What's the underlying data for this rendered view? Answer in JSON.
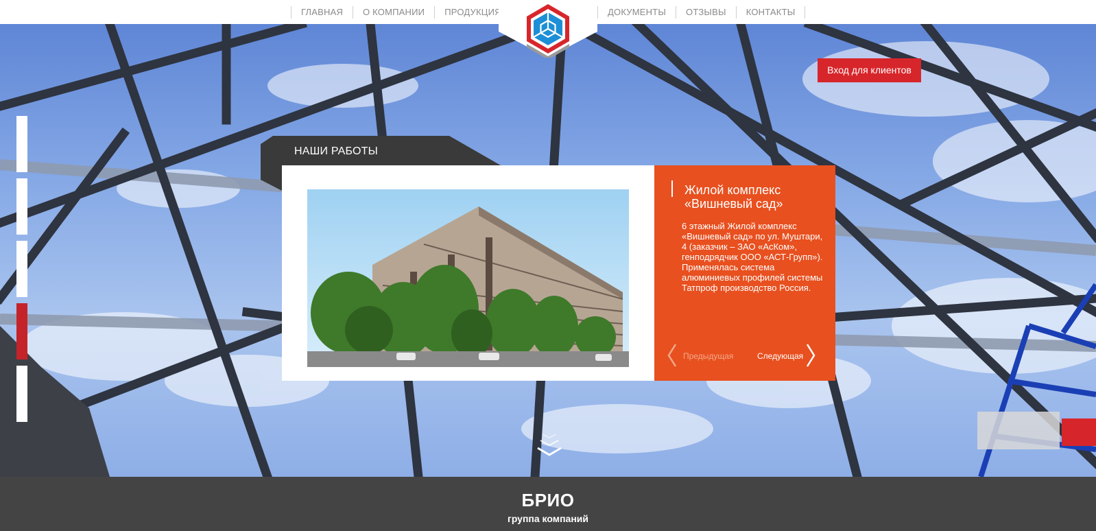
{
  "nav": {
    "left": [
      "ГЛАВНАЯ",
      "О КОМПАНИИ",
      "ПРОДУКЦИЯ"
    ],
    "right": [
      "ДОКУМЕНТЫ",
      "ОТЗЫВЫ",
      "КОНТАКТЫ"
    ]
  },
  "login_label": "Вход для клиентов",
  "works": {
    "section_title": "НАШИ РАБОТЫ",
    "project_title": "Жилой комплекс «Вишневый сад»",
    "project_description": "6 этажный Жилой комплекс «Вишневый сад» по ул. Муштари, 4 (заказчик – ЗАО «АсКом», генподрядчик ООО «АСТ-Групп»). Применялась система алюминиевых профилей системы Татпроф производство Россия.",
    "prev_label": "Предыдущая",
    "next_label": "Следующая"
  },
  "side_nav": {
    "count": 5,
    "active_index": 3
  },
  "footer": {
    "brand": "БРИО",
    "subtitle": "группа компаний"
  },
  "colors": {
    "accent_red": "#d7262b",
    "card_orange": "#e8501f",
    "footer_bg": "#444444",
    "tab_dark": "#3a3a3a"
  }
}
